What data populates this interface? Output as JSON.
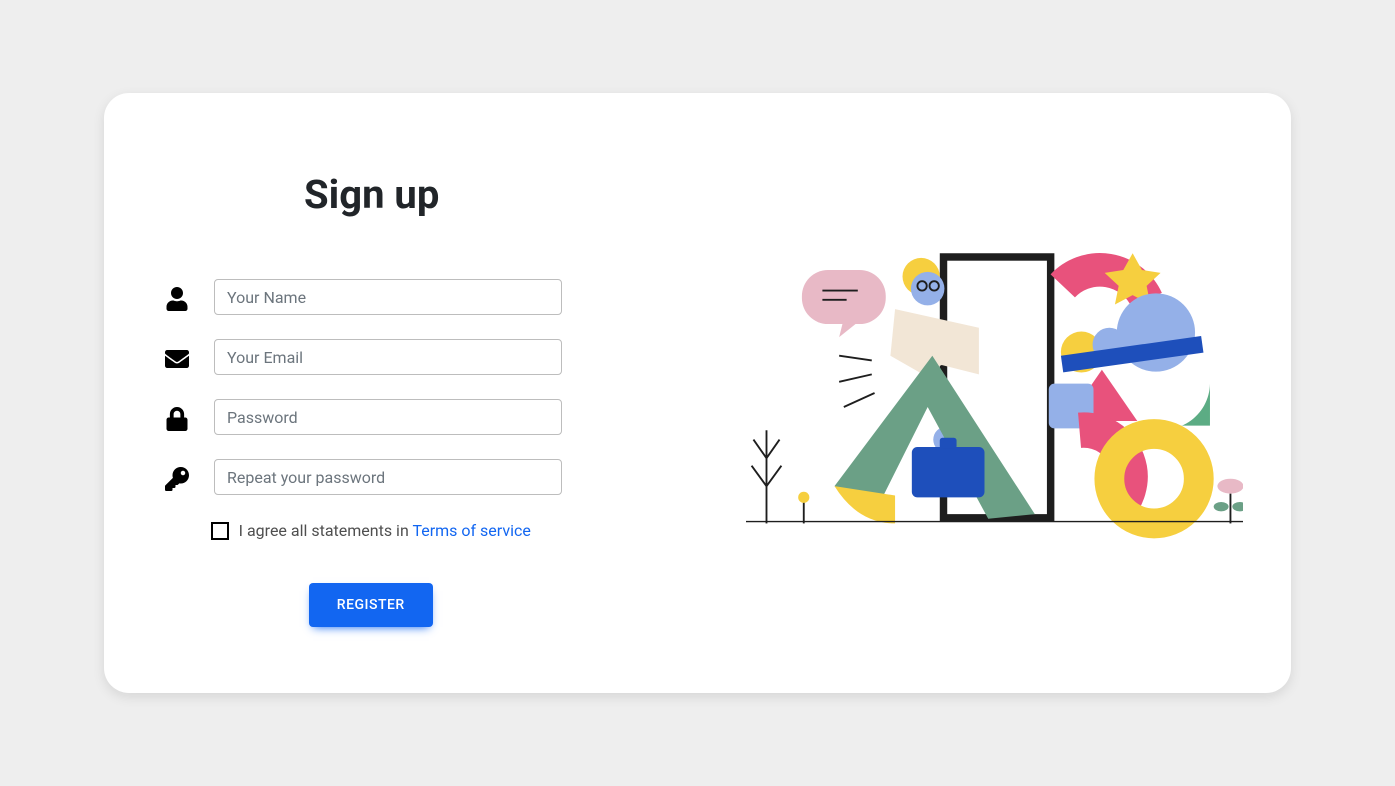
{
  "heading": "Sign up",
  "fields": {
    "name_placeholder": "Your Name",
    "email_placeholder": "Your Email",
    "password_placeholder": "Password",
    "repeat_password_placeholder": "Repeat your password"
  },
  "terms": {
    "prefix": "I agree all statements in ",
    "link_label": "Terms of service"
  },
  "register_label": "REGISTER",
  "colors": {
    "primary": "#1266f1",
    "background": "#eee",
    "card": "#fff",
    "text": "#4f4f4f"
  }
}
